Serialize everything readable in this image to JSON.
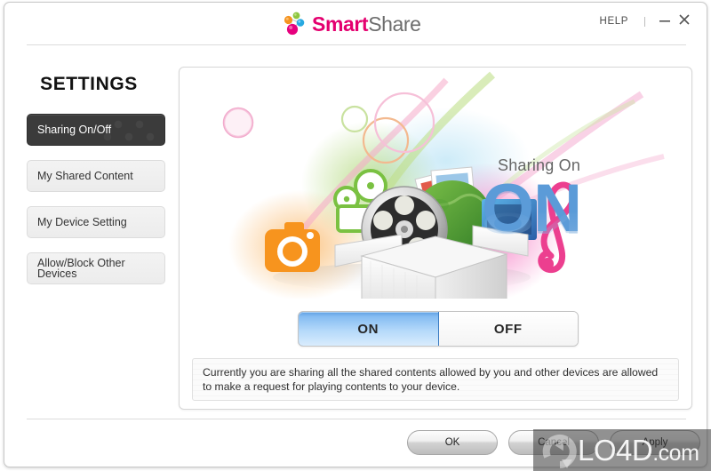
{
  "window": {
    "app_name": "SmartShare",
    "brand_smart": "Smart",
    "brand_share": "Share",
    "help_label": "HELP",
    "minimize_icon": "minimize-icon",
    "close_icon": "close-icon",
    "brand_dot_colors": [
      "#f08a1e",
      "#8cc63e",
      "#27a9e1",
      "#e6007e"
    ]
  },
  "sidebar": {
    "title": "SETTINGS",
    "items": [
      {
        "label": "Sharing On/Off",
        "active": true
      },
      {
        "label": "My Shared Content",
        "active": false
      },
      {
        "label": "My Device Setting",
        "active": false
      },
      {
        "label": "Allow/Block Other Devices",
        "active": false
      }
    ]
  },
  "main": {
    "hero": {
      "status_label": "Sharing On",
      "status_value": "ON",
      "status_color": "#5b9bd8",
      "icons": [
        "camera-icon",
        "movie-camera-icon",
        "film-reel-icon",
        "photo-stack-icon",
        "music-note-icon",
        "open-box-icon"
      ]
    },
    "toggle": {
      "on_label": "ON",
      "off_label": "OFF",
      "selected": "ON",
      "on_color": "#5e9fe3"
    },
    "description": "Currently you are sharing all the shared contents allowed by you and other devices are allowed to make a request for playing contents to your device."
  },
  "footer": {
    "buttons": [
      {
        "label": "OK"
      },
      {
        "label": "Cancel"
      },
      {
        "label": "Apply"
      }
    ]
  },
  "watermark": {
    "text": "LO4D",
    "suffix": ".com",
    "icon": "refresh-circle-icon"
  }
}
